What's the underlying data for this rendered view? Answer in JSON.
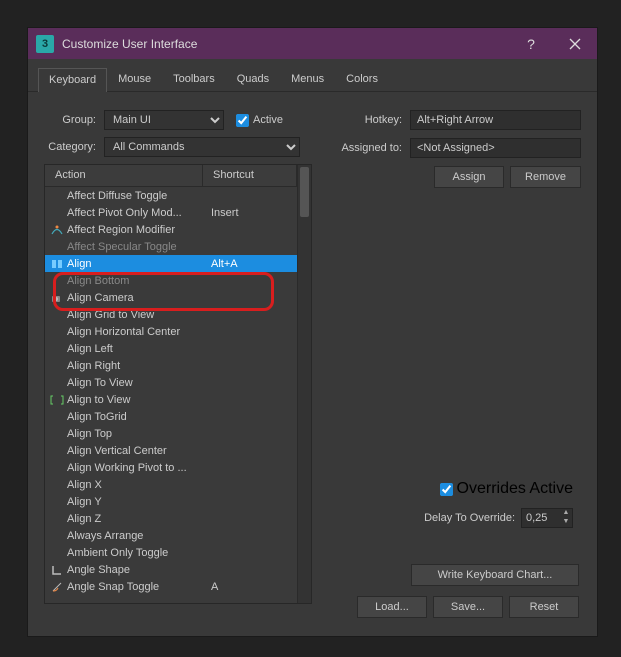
{
  "window": {
    "title": "Customize User Interface",
    "app_icon_text": "3"
  },
  "tabs": [
    "Keyboard",
    "Mouse",
    "Toolbars",
    "Quads",
    "Menus",
    "Colors"
  ],
  "active_tab": 0,
  "group": {
    "label": "Group:",
    "value": "Main UI"
  },
  "active_checkbox": {
    "label": "Active",
    "checked": true
  },
  "category": {
    "label": "Category:",
    "value": "All Commands"
  },
  "columns": {
    "action": "Action",
    "shortcut": "Shortcut"
  },
  "actions": [
    {
      "name": "Affect Diffuse Toggle",
      "shortcut": "",
      "icon": ""
    },
    {
      "name": "Affect Pivot Only Mod...",
      "shortcut": "Insert",
      "icon": ""
    },
    {
      "name": "Affect Region Modifier",
      "shortcut": "",
      "icon": "region"
    },
    {
      "name": "Affect Specular Toggle",
      "shortcut": "",
      "icon": "",
      "dimmed": true
    },
    {
      "name": "Align",
      "shortcut": "Alt+A",
      "icon": "align",
      "selected": true
    },
    {
      "name": "Align Bottom",
      "shortcut": "",
      "icon": "",
      "dimmed": true
    },
    {
      "name": "Align Camera",
      "shortcut": "",
      "icon": "camera"
    },
    {
      "name": "Align Grid to View",
      "shortcut": "",
      "icon": ""
    },
    {
      "name": "Align Horizontal Center",
      "shortcut": "",
      "icon": ""
    },
    {
      "name": "Align Left",
      "shortcut": "",
      "icon": ""
    },
    {
      "name": "Align Right",
      "shortcut": "",
      "icon": ""
    },
    {
      "name": "Align To View",
      "shortcut": "",
      "icon": ""
    },
    {
      "name": "Align to View",
      "shortcut": "",
      "icon": "brackets"
    },
    {
      "name": "Align ToGrid",
      "shortcut": "",
      "icon": ""
    },
    {
      "name": "Align Top",
      "shortcut": "",
      "icon": ""
    },
    {
      "name": "Align Vertical Center",
      "shortcut": "",
      "icon": ""
    },
    {
      "name": "Align Working Pivot to ...",
      "shortcut": "",
      "icon": ""
    },
    {
      "name": "Align X",
      "shortcut": "",
      "icon": ""
    },
    {
      "name": "Align Y",
      "shortcut": "",
      "icon": ""
    },
    {
      "name": "Align Z",
      "shortcut": "",
      "icon": ""
    },
    {
      "name": "Always Arrange",
      "shortcut": "",
      "icon": ""
    },
    {
      "name": "Ambient Only Toggle",
      "shortcut": "",
      "icon": ""
    },
    {
      "name": "Angle Shape",
      "shortcut": "",
      "icon": "angle"
    },
    {
      "name": "Angle Snap Toggle",
      "shortcut": "A",
      "icon": "anglesnap"
    }
  ],
  "hotkey": {
    "label": "Hotkey:",
    "value": "Alt+Right Arrow"
  },
  "assigned_to": {
    "label": "Assigned to:",
    "value": "<Not Assigned>"
  },
  "buttons": {
    "assign": "Assign",
    "remove": "Remove",
    "write_chart": "Write Keyboard Chart...",
    "load": "Load...",
    "save": "Save...",
    "reset": "Reset"
  },
  "overrides_active": {
    "label": "Overrides Active",
    "checked": true
  },
  "delay": {
    "label": "Delay To Override:",
    "value": "0,25"
  }
}
